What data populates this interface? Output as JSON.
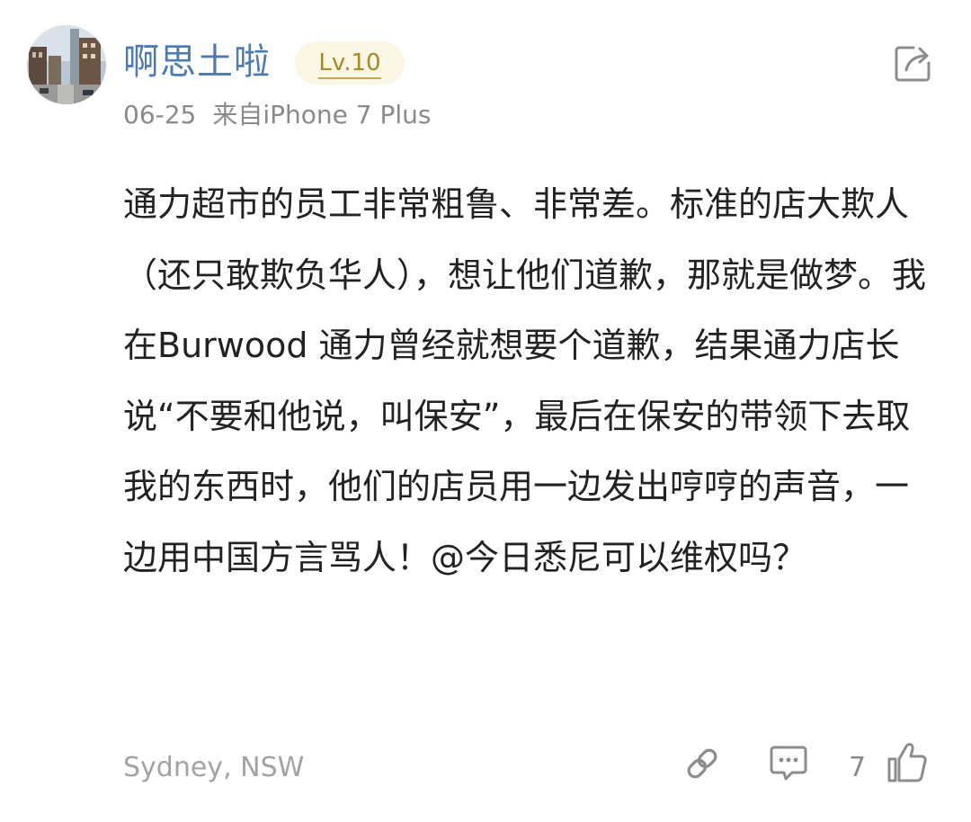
{
  "post": {
    "username": "啊思土啦",
    "level": "Lv.10",
    "date": "06-25",
    "source": "来自iPhone 7 Plus",
    "content": "通力超市的员工非常粗鲁、非常差。标准的店大欺人（还只敢欺负华人），想让他们道歉，那就是做梦。我在Burwood 通力曾经就想要个道歉，结果通力店长说“不要和他说，叫保安”，最后在保安的带领下去取我的东西时，他们的店员用一边发出哼哼的声音，一边用中国方言骂人！@今日悉尼可以维权吗？",
    "location": "Sydney,  NSW",
    "like_count": "7"
  },
  "icons": {
    "share": "share-icon",
    "link": "link-icon",
    "comment": "comment-icon",
    "like": "thumbs-up-icon"
  },
  "colors": {
    "username": "#4b7bb0",
    "badge_bg": "#fbf6e3",
    "badge_text": "#a88a24",
    "meta": "#8a8a8a",
    "body_text": "#222222",
    "icon": "#8c8c8c"
  }
}
